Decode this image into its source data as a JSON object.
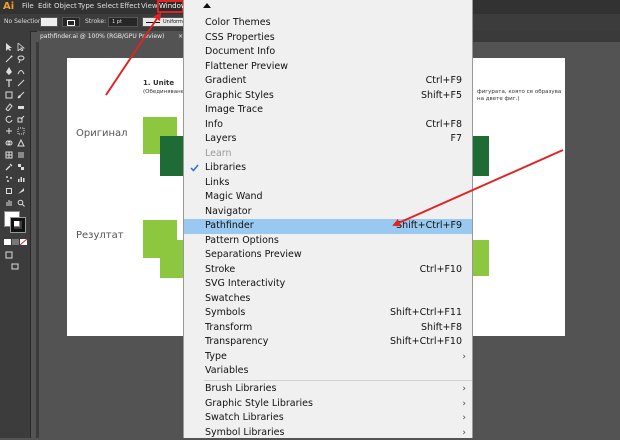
{
  "app": {
    "logo": "Ai"
  },
  "menubar": {
    "items": [
      "File",
      "Edit",
      "Object",
      "Type",
      "Select",
      "Effect",
      "View"
    ],
    "window_label": "Window"
  },
  "control_bar": {
    "selection_label": "No Selection",
    "stroke_label": "Stroke:",
    "stroke_value": "1 pt",
    "profile_label": "Uniform"
  },
  "document_tab": {
    "title": "pathfinder.ai @ 100% (RGB/GPU Preview)",
    "close": "×"
  },
  "artboard": {
    "heading": "1. Unite",
    "subheading": "(Обединяване",
    "right_text_1": "фигурата, която се образува",
    "right_text_2": "на двете фиг.)",
    "label_original": "Оригинал",
    "label_result": "Резултат",
    "colors": {
      "light_green": "#8dc63f",
      "dark_green": "#1f6b35"
    }
  },
  "window_menu": {
    "items": [
      {
        "label": "Color Themes",
        "shortcut": ""
      },
      {
        "label": "CSS Properties",
        "shortcut": ""
      },
      {
        "label": "Document Info",
        "shortcut": ""
      },
      {
        "label": "Flattener Preview",
        "shortcut": ""
      },
      {
        "label": "Gradient",
        "shortcut": "Ctrl+F9"
      },
      {
        "label": "Graphic Styles",
        "shortcut": "Shift+F5"
      },
      {
        "label": "Image Trace",
        "shortcut": ""
      },
      {
        "label": "Info",
        "shortcut": "Ctrl+F8"
      },
      {
        "label": "Layers",
        "shortcut": "F7"
      },
      {
        "label": "Learn",
        "shortcut": ""
      },
      {
        "label": "Libraries",
        "shortcut": ""
      },
      {
        "label": "Links",
        "shortcut": ""
      },
      {
        "label": "Magic Wand",
        "shortcut": ""
      },
      {
        "label": "Navigator",
        "shortcut": ""
      },
      {
        "label": "Pathfinder",
        "shortcut": "Shift+Ctrl+F9"
      },
      {
        "label": "Pattern Options",
        "shortcut": ""
      },
      {
        "label": "Separations Preview",
        "shortcut": ""
      },
      {
        "label": "Stroke",
        "shortcut": "Ctrl+F10"
      },
      {
        "label": "SVG Interactivity",
        "shortcut": ""
      },
      {
        "label": "Swatches",
        "shortcut": ""
      },
      {
        "label": "Symbols",
        "shortcut": "Shift+Ctrl+F11"
      },
      {
        "label": "Transform",
        "shortcut": "Shift+F8"
      },
      {
        "label": "Transparency",
        "shortcut": "Shift+Ctrl+F10"
      },
      {
        "label": "Type",
        "shortcut": ""
      },
      {
        "label": "Variables",
        "shortcut": ""
      },
      {
        "label": "Brush Libraries",
        "shortcut": ""
      },
      {
        "label": "Graphic Style Libraries",
        "shortcut": ""
      },
      {
        "label": "Swatch Libraries",
        "shortcut": ""
      },
      {
        "label": "Symbol Libraries",
        "shortcut": ""
      }
    ],
    "highlight_color": "#99c9f1",
    "annotation_color": "#e02424"
  }
}
